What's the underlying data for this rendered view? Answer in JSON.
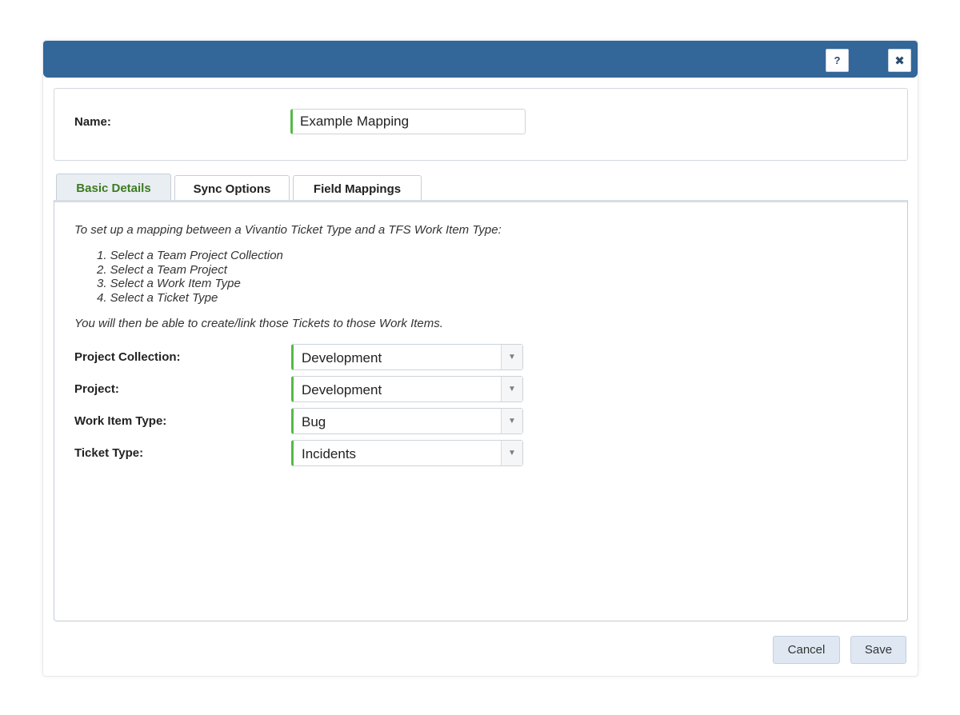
{
  "titlebar": {
    "help_label": "?",
    "close_label": "✖"
  },
  "name_panel": {
    "label": "Name:",
    "value": "Example Mapping"
  },
  "tabs": [
    {
      "label": "Basic Details",
      "active": true
    },
    {
      "label": "Sync Options",
      "active": false
    },
    {
      "label": "Field Mappings",
      "active": false
    }
  ],
  "basic_details": {
    "intro": "To set up a mapping between a Vivantio Ticket Type and a TFS Work Item Type:",
    "steps": [
      "1. Select a Team Project Collection",
      "2. Select a Team Project",
      "3. Select a Work Item Type",
      "4. Select a Ticket Type"
    ],
    "outro": "You will then be able to create/link those Tickets to those Work Items.",
    "fields": [
      {
        "label": "Project Collection:",
        "value": "Development"
      },
      {
        "label": "Project:",
        "value": "Development"
      },
      {
        "label": "Work Item Type:",
        "value": "Bug"
      },
      {
        "label": "Ticket Type:",
        "value": "Incidents"
      }
    ],
    "dropdown_arrow": "▼"
  },
  "footer": {
    "cancel_label": "Cancel",
    "save_label": "Save"
  },
  "colors": {
    "titlebar": "#336699",
    "required_accent": "#55b948",
    "active_tab_text": "#3e7a21",
    "button_bg": "#dfe8f2"
  },
  "icons": {
    "help": "help-icon",
    "close": "close-icon",
    "dropdown": "chevron-down-icon"
  }
}
